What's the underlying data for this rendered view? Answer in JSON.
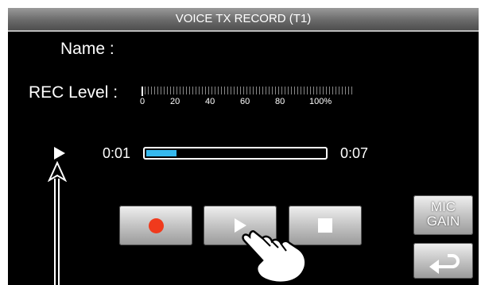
{
  "title": "VOICE TX RECORD  (T1)",
  "name_label": "Name :",
  "rec_level": {
    "label": "REC Level :",
    "scale": [
      "0",
      "20",
      "40",
      "60",
      "80",
      "100%"
    ]
  },
  "playback": {
    "elapsed": "0:01",
    "total": "0:07",
    "progress_fraction": 0.17
  },
  "buttons": {
    "mic_gain": [
      "MIC",
      "GAIN"
    ]
  },
  "colors": {
    "accent_progress": "#36b9ee",
    "record_dot": "#f03a1c",
    "titlebar": "#7a7a7a"
  },
  "icons": [
    "play-indicator-icon",
    "record-icon",
    "play-icon",
    "stop-icon",
    "return-icon",
    "hand-pointer-icon",
    "up-arrow-icon"
  ]
}
